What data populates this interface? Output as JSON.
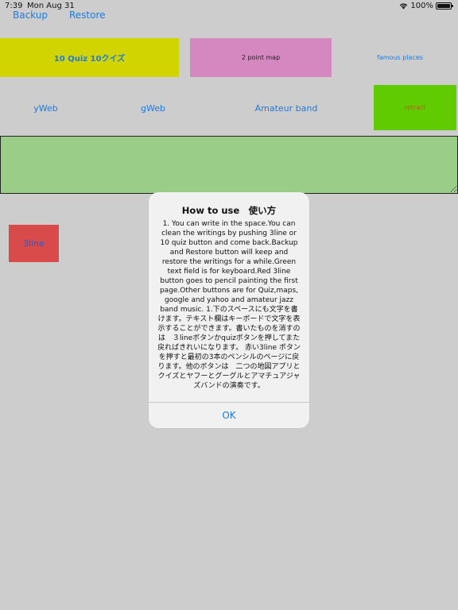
{
  "status_bar": {
    "time": "7:39",
    "date": "Mon Aug 31",
    "battery": "100%",
    "icons": [
      "wifi-icon",
      "battery-icon"
    ]
  },
  "top_links": {
    "backup": "Backup",
    "restore": "Restore"
  },
  "buttons": {
    "quiz": "10 Quiz 10クイズ",
    "point_map": "2  point map",
    "famous_places": "famous places",
    "yweb": "yWeb",
    "gweb": "gWeb",
    "amateur_band": "Amateur band",
    "retract": "retract",
    "three_line": "3line"
  },
  "text_field": {
    "value": ""
  },
  "alert": {
    "title": "How to use　使い方",
    "message": "1. You can write in the space.You can clean the writings by pushing 3line or 10 quiz button and come back.Backup and Restore button will keep and restore the writings for a while.Green text field is for keyboard.Red 3line button  goes to pencil painting the first page.Other buttons are for Quiz,maps, google and yahoo and amateur jazz band music.  1.下のスペースにも文字を書けます。テキスト欄はキーボードで文字を表示することができます。書いたものを消すのは　３lineボタンかquizボタンを押してまた戻ればきれいになります。 赤い3line ボタンを押すと最初の3本のペンシルのページに戻ります。他のボタンは　二つの地図アプリとクイズとヤフーとグーグルとアマチュアジャズバンドの演奏です。",
    "ok": "OK"
  },
  "colors": {
    "background": "#cdcdcd",
    "link_blue": "#1f7ae0",
    "quiz_yellow": "#d2d400",
    "map_pink": "#d587c0",
    "retract_green": "#5fcb00",
    "text_field_green": "#9acd88",
    "three_line_red": "#d94b4a",
    "retract_text": "#c05a1f"
  }
}
